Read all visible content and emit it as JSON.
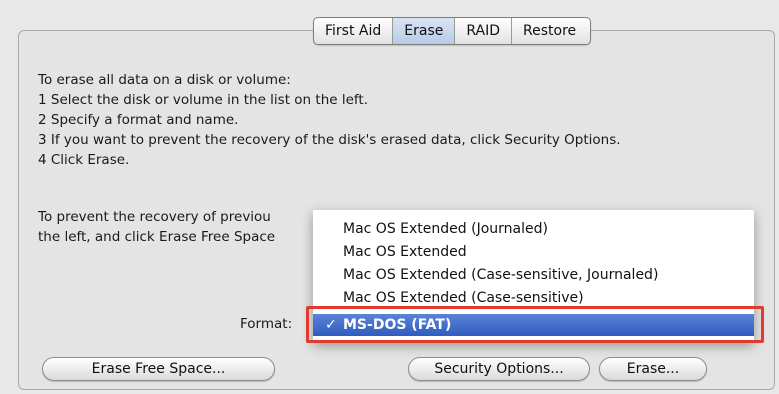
{
  "tabs": [
    {
      "label": "First Aid",
      "active": false
    },
    {
      "label": "Erase",
      "active": true
    },
    {
      "label": "RAID",
      "active": false
    },
    {
      "label": "Restore",
      "active": false
    }
  ],
  "instructions": {
    "intro": "To erase all data on a disk or volume:",
    "step1": "1 Select the disk or volume in the list on the left.",
    "step2": "2 Specify a format and name.",
    "step3": "3 If you want to prevent the recovery of the disk's erased data, click Security Options.",
    "step4": "4 Click Erase."
  },
  "free_space_note": {
    "line1": "To prevent the recovery of previou",
    "line2": "the left, and click Erase Free Space"
  },
  "format": {
    "label": "Format:",
    "options": [
      "Mac OS Extended (Journaled)",
      "Mac OS Extended",
      "Mac OS Extended (Case-sensitive, Journaled)",
      "Mac OS Extended (Case-sensitive)",
      "MS-DOS (FAT)"
    ],
    "selected": "MS-DOS (FAT)",
    "checkmark": "✓"
  },
  "buttons": {
    "erase_free_space": "Erase Free Space...",
    "security_options": "Security Options...",
    "erase": "Erase..."
  },
  "colors": {
    "highlight_border": "#e23b2e",
    "selection": "#3a66c8"
  }
}
